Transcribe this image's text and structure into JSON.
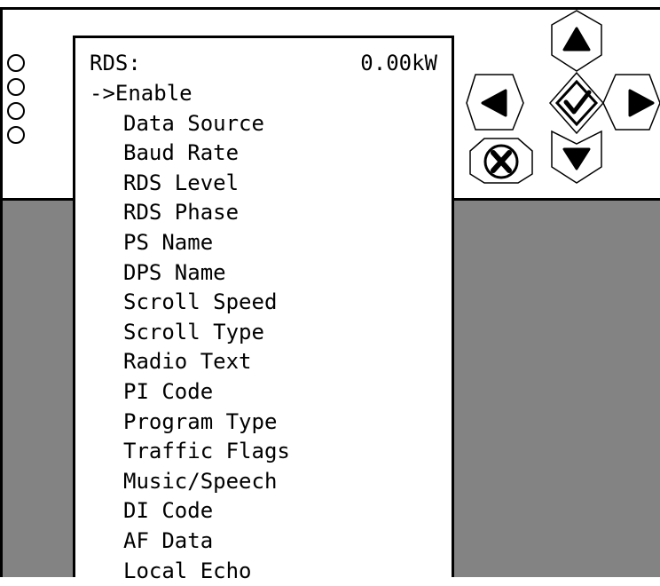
{
  "screen": {
    "header_title": "RDS:",
    "header_power": "0.00kW",
    "cursor": "->",
    "items": [
      "Enable",
      "Data Source",
      "Baud Rate",
      "RDS Level",
      "RDS Phase",
      "PS Name",
      "DPS Name",
      "Scroll Speed",
      "Scroll Type",
      "Radio Text",
      "PI Code",
      "Program Type",
      "Traffic Flags",
      "Music/Speech",
      "DI Code",
      "AF Data",
      "Local Echo"
    ],
    "selected_index": 0
  },
  "leds": [
    "led-1",
    "led-2",
    "led-3",
    "led-4"
  ],
  "nav_buttons": {
    "up": "up-arrow-icon",
    "down": "down-arrow-icon",
    "left": "left-arrow-icon",
    "right": "right-arrow-icon",
    "ok": "checkmark-icon",
    "cancel": "x-cancel-icon"
  },
  "colors": {
    "background_gray": "#838383",
    "panel": "#ffffff",
    "ink": "#000000"
  }
}
